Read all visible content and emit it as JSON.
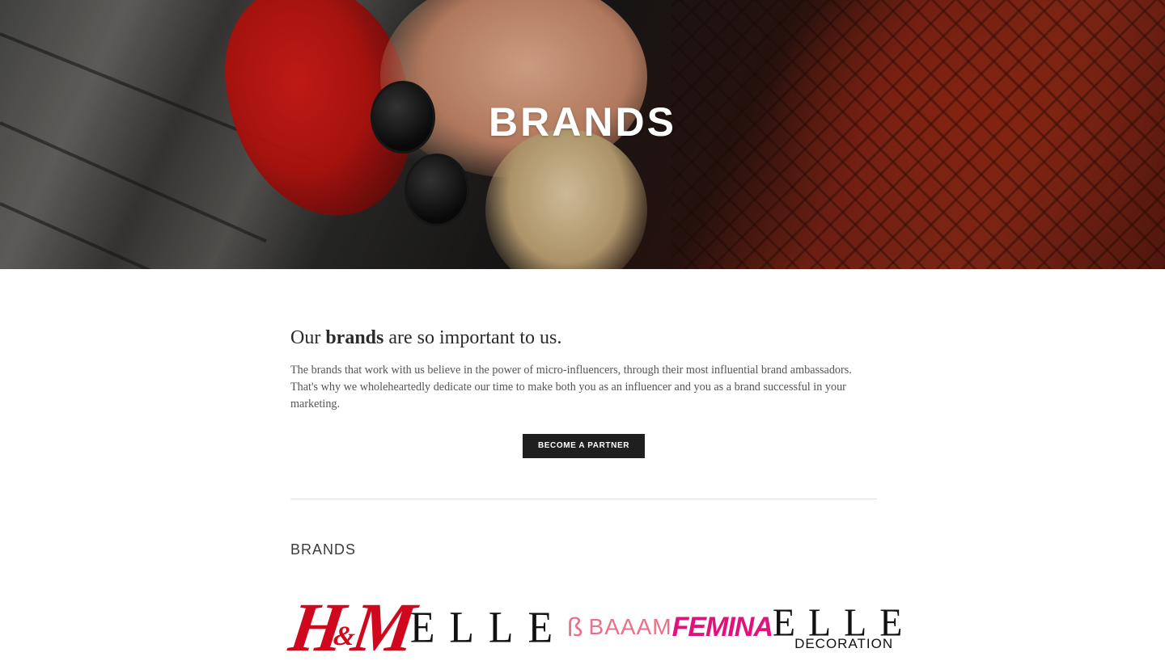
{
  "hero": {
    "title": "BRANDS"
  },
  "intro": {
    "headline_pre": "Our ",
    "headline_bold": "brands",
    "headline_post": " are so important to us.",
    "body": "The brands that work with us believe in the power of micro-influencers, through their most influential brand ambassadors. That's why we wholeheartedly dedicate our time to make both you as an influencer and you as a brand successful in your marketing.",
    "cta_label": "BECOME A PARTNER"
  },
  "brands": {
    "title": "BRANDS",
    "logos": [
      {
        "name": "H&M",
        "color": "#d0081e",
        "part1": "H",
        "amp": "&",
        "part2": "M"
      },
      {
        "name": "ELLE",
        "color": "#111111"
      },
      {
        "name": "BAAAM",
        "color": "#e8728a",
        "mark": "ß"
      },
      {
        "name": "FEMINA",
        "color": "#e0127e"
      },
      {
        "name": "ELLE DECORATION",
        "color": "#111111",
        "line1": "ELLE",
        "line2": "DECORATION"
      }
    ]
  },
  "colors": {
    "cta_background": "#1f1f1f",
    "divider": "#e2e2e2"
  }
}
